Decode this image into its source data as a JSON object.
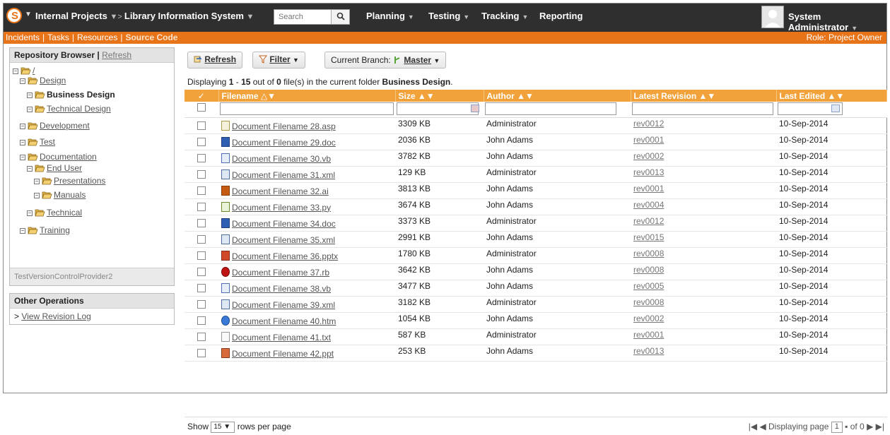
{
  "topbar": {
    "logo_letter": "S",
    "project": "Internal Projects",
    "product": "Library Information System",
    "search_placeholder": "Search",
    "nav": [
      "Planning",
      "Testing",
      "Tracking",
      "Reporting"
    ],
    "user": "System Administrator"
  },
  "subbar": {
    "links": [
      "Incidents",
      "Tasks",
      "Resources",
      "Source Code"
    ],
    "role": "Role: Project Owner"
  },
  "sidebar": {
    "title": "Repository Browser",
    "refresh": "Refresh",
    "tree": [
      {
        "label": "/",
        "depth": 0,
        "current": false
      },
      {
        "label": "Design",
        "depth": 1,
        "current": false
      },
      {
        "label": "Business Design",
        "depth": 2,
        "current": true
      },
      {
        "label": "Technical Design",
        "depth": 2,
        "current": false
      },
      {
        "label": "Development",
        "depth": 1,
        "current": false
      },
      {
        "label": "Test",
        "depth": 1,
        "current": false
      },
      {
        "label": "Documentation",
        "depth": 1,
        "current": false
      },
      {
        "label": "End User",
        "depth": 2,
        "current": false
      },
      {
        "label": "Presentations",
        "depth": 3,
        "current": false
      },
      {
        "label": "Manuals",
        "depth": 3,
        "current": false
      },
      {
        "label": "Technical",
        "depth": 2,
        "current": false
      },
      {
        "label": "Training",
        "depth": 1,
        "current": false
      }
    ],
    "provider": "TestVersionControlProvider2",
    "ops_title": "Other Operations",
    "ops_link": "View Revision Log"
  },
  "toolbar": {
    "refresh": "Refresh",
    "filter": "Filter",
    "branch_label": "Current Branch:",
    "branch_value": "Master"
  },
  "info": {
    "prefix": "Displaying ",
    "from": "1",
    "sep": " - ",
    "to": "15",
    "mid": " out of ",
    "total": "0",
    "suffix": " file(s) in the current folder ",
    "folder": "Business Design",
    "end": "."
  },
  "table": {
    "headers": {
      "check": "✓",
      "filename": "Filename △▼",
      "size": "Size ▲▼",
      "author": "Author ▲▼",
      "revision": "Latest Revision ▲▼",
      "edited": "Last Edited ▲▼"
    },
    "rows": [
      {
        "name": "Document Filename 28.asp",
        "icon": "asp",
        "size": "3309 KB",
        "author": "Administrator",
        "rev": "rev0012",
        "date": "10-Sep-2014"
      },
      {
        "name": "Document Filename 29.doc",
        "icon": "doc",
        "size": "2036 KB",
        "author": "John Adams",
        "rev": "rev0001",
        "date": "10-Sep-2014"
      },
      {
        "name": "Document Filename 30.vb",
        "icon": "vb",
        "size": "3782 KB",
        "author": "John Adams",
        "rev": "rev0002",
        "date": "10-Sep-2014"
      },
      {
        "name": "Document Filename 31.xml",
        "icon": "xml",
        "size": "129 KB",
        "author": "Administrator",
        "rev": "rev0013",
        "date": "10-Sep-2014"
      },
      {
        "name": "Document Filename 32.ai",
        "icon": "ai",
        "size": "3813 KB",
        "author": "John Adams",
        "rev": "rev0001",
        "date": "10-Sep-2014"
      },
      {
        "name": "Document Filename 33.py",
        "icon": "py",
        "size": "3674 KB",
        "author": "John Adams",
        "rev": "rev0004",
        "date": "10-Sep-2014"
      },
      {
        "name": "Document Filename 34.doc",
        "icon": "doc",
        "size": "3373 KB",
        "author": "Administrator",
        "rev": "rev0012",
        "date": "10-Sep-2014"
      },
      {
        "name": "Document Filename 35.xml",
        "icon": "xml",
        "size": "2991 KB",
        "author": "John Adams",
        "rev": "rev0015",
        "date": "10-Sep-2014"
      },
      {
        "name": "Document Filename 36.pptx",
        "icon": "pptx",
        "size": "1780 KB",
        "author": "Administrator",
        "rev": "rev0008",
        "date": "10-Sep-2014"
      },
      {
        "name": "Document Filename 37.rb",
        "icon": "rb",
        "size": "3642 KB",
        "author": "John Adams",
        "rev": "rev0008",
        "date": "10-Sep-2014"
      },
      {
        "name": "Document Filename 38.vb",
        "icon": "vb",
        "size": "3477 KB",
        "author": "John Adams",
        "rev": "rev0005",
        "date": "10-Sep-2014"
      },
      {
        "name": "Document Filename 39.xml",
        "icon": "xml",
        "size": "3182 KB",
        "author": "Administrator",
        "rev": "rev0008",
        "date": "10-Sep-2014"
      },
      {
        "name": "Document Filename 40.htm",
        "icon": "htm",
        "size": "1054 KB",
        "author": "John Adams",
        "rev": "rev0002",
        "date": "10-Sep-2014"
      },
      {
        "name": "Document Filename 41.txt",
        "icon": "txt",
        "size": "587 KB",
        "author": "Administrator",
        "rev": "rev0001",
        "date": "10-Sep-2014"
      },
      {
        "name": "Document Filename 42.ppt",
        "icon": "ppt",
        "size": "253 KB",
        "author": "John Adams",
        "rev": "rev0013",
        "date": "10-Sep-2014"
      }
    ]
  },
  "footer": {
    "show": "Show",
    "per_page_value": "15",
    "per_page_suffix": "rows per page",
    "displaying_page": "Displaying page",
    "page": "1",
    "of": "of 0"
  },
  "colors": {
    "topbar": "#2f2f2f",
    "accent_orange": "#e8741a",
    "table_header": "#f2a23a"
  }
}
